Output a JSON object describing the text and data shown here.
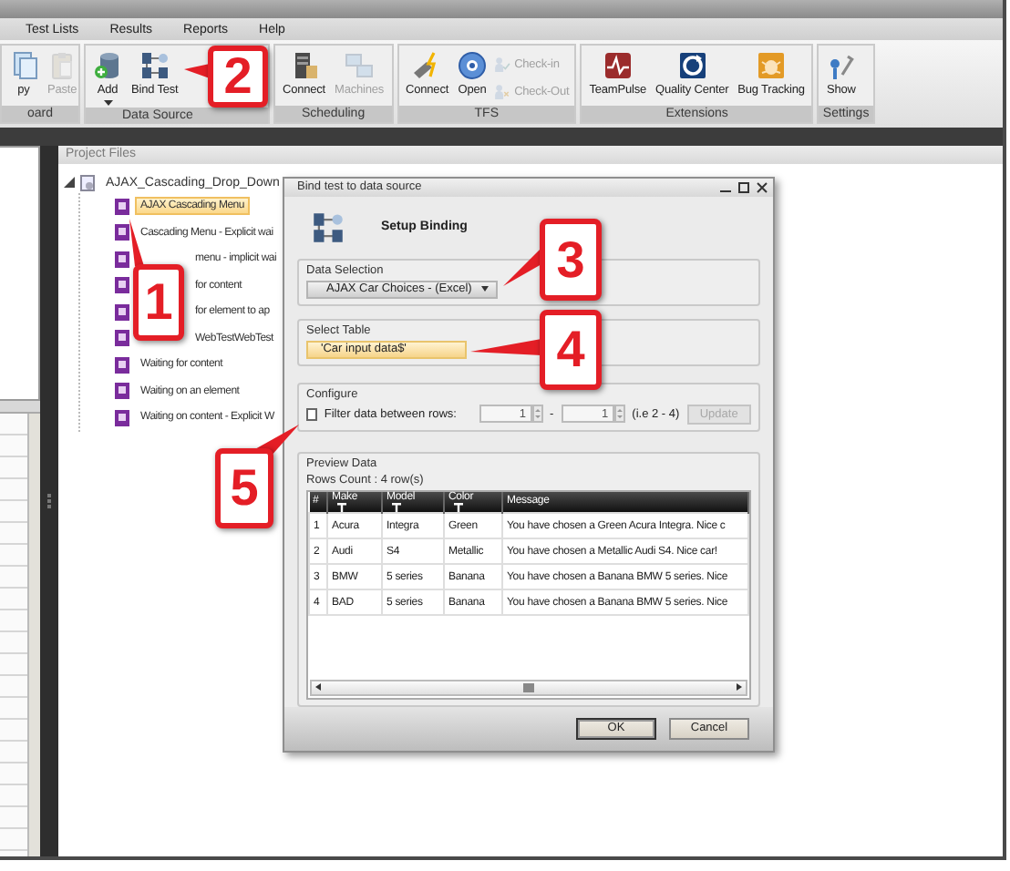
{
  "menu_bar": [
    "Test Lists",
    "Results",
    "Reports",
    "Help"
  ],
  "ribbon": [
    {
      "label": "oard",
      "buttons": [
        {
          "kind": "large",
          "label": "py",
          "disabled": false
        },
        {
          "kind": "large",
          "label": "Paste",
          "disabled": true
        }
      ]
    },
    {
      "label": "Data Source",
      "buttons": [
        {
          "kind": "menu",
          "label": "Add",
          "disabled": false
        },
        {
          "kind": "large",
          "label": "Bind Test",
          "disabled": false
        }
      ]
    },
    {
      "label": "Scheduling",
      "buttons": [
        {
          "kind": "large",
          "label": "Connect",
          "disabled": false
        },
        {
          "kind": "large",
          "label": "Machines",
          "disabled": true
        }
      ]
    },
    {
      "label": "TFS",
      "buttons": [
        {
          "kind": "large",
          "label": "Connect",
          "disabled": false
        },
        {
          "kind": "large",
          "label": "Open",
          "disabled": false
        },
        {
          "kind": "small",
          "label": "Check-in",
          "disabled": true
        },
        {
          "kind": "small",
          "label": "Check-Out",
          "disabled": true
        }
      ]
    },
    {
      "label": "Extensions",
      "buttons": [
        {
          "kind": "large",
          "label": "TeamPulse",
          "disabled": false
        },
        {
          "kind": "large",
          "label": "Quality Center",
          "disabled": false
        },
        {
          "kind": "large",
          "label": "Bug Tracking",
          "disabled": false
        }
      ]
    },
    {
      "label": "Settings",
      "buttons": [
        {
          "kind": "large",
          "label": "Show",
          "disabled": false
        }
      ]
    }
  ],
  "project_files": {
    "title": "Project Files",
    "root": {
      "label": "AJAX_Cascading_Drop_Down",
      "expanded": true,
      "children": [
        {
          "label": "AJAX Cascading Menu",
          "selected": true,
          "covered": false
        },
        {
          "label": "Cascading Menu - Explicit wai",
          "selected": false,
          "covered": false
        },
        {
          "label": "menu - implicit wai",
          "selected": false,
          "covered": true
        },
        {
          "label": "for content",
          "selected": false,
          "covered": true
        },
        {
          "label": "for element to ap",
          "selected": false,
          "covered": true
        },
        {
          "label": "WebTestWebTest",
          "selected": false,
          "covered": true
        },
        {
          "label": "Waiting for content",
          "selected": false,
          "covered": false
        },
        {
          "label": "Waiting on an element",
          "selected": false,
          "covered": false
        },
        {
          "label": "Waiting on content - Explicit W",
          "selected": false,
          "covered": false
        }
      ]
    }
  },
  "dialog": {
    "title": "Bind test to data source",
    "heading": "Setup Binding",
    "data_selection": {
      "label": "Data Selection",
      "value": "AJAX Car Choices - (Excel)"
    },
    "select_table": {
      "label": "Select Table",
      "value": "'Car input data$'",
      "selected": true
    },
    "configure": {
      "label": "Configure",
      "filter_checkbox": {
        "label": "Filter data between rows:",
        "checked": false
      },
      "from": {
        "value": "1",
        "disabled": true
      },
      "separator": "-",
      "to": {
        "value": "1",
        "disabled": true
      },
      "hint": "(i.e 2 - 4)",
      "update_button": {
        "label": "Update",
        "disabled": true
      }
    },
    "preview": {
      "label": "Preview Data",
      "rows_count": "Rows Count : 4 row(s)",
      "columns": [
        {
          "label": "#",
          "filter": false
        },
        {
          "label": "Make",
          "filter": true
        },
        {
          "label": "Model",
          "filter": true
        },
        {
          "label": "Color",
          "filter": true
        },
        {
          "label": "Message",
          "filter": false
        }
      ],
      "rows": [
        [
          "1",
          "Acura",
          "Integra",
          "Green",
          "You have chosen a Green Acura Integra. Nice c"
        ],
        [
          "2",
          "Audi",
          "S4",
          "Metallic",
          "You have chosen a Metallic Audi S4. Nice car!"
        ],
        [
          "3",
          "BMW",
          "5 series",
          "Banana",
          "You have chosen a Banana BMW 5 series. Nice"
        ],
        [
          "4",
          "BAD",
          "5 series",
          "Banana",
          "You have chosen a Banana BMW 5 series. Nice"
        ]
      ]
    },
    "buttons": [
      {
        "label": "OK",
        "default": true
      },
      {
        "label": "Cancel",
        "default": false
      }
    ]
  },
  "callouts": [
    "1",
    "2",
    "3",
    "4",
    "5"
  ]
}
